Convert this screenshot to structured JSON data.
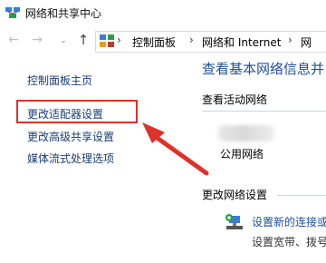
{
  "window": {
    "title": "网络和共享中心"
  },
  "address": {
    "crumbs": [
      "控制面板",
      "网络和 Internet",
      "网"
    ],
    "separator": "›"
  },
  "nav": {
    "back": "←",
    "forward": "→",
    "dropdown": "⌄",
    "up": "↑"
  },
  "left": {
    "items": [
      "控制面板主页",
      "更改适配器设置",
      "更改高级共享设置",
      "媒体流式处理选项"
    ]
  },
  "right": {
    "heading": "查看基本网络信息并",
    "active_label": "查看活动网络",
    "network_name": "公用网络",
    "change_label": "更改网络设置",
    "setup_link": "设置新的连接或",
    "setup_desc": "设置宽带、拨号"
  },
  "colors": {
    "accent": "#1f4e9c",
    "highlight": "#e0302a"
  }
}
